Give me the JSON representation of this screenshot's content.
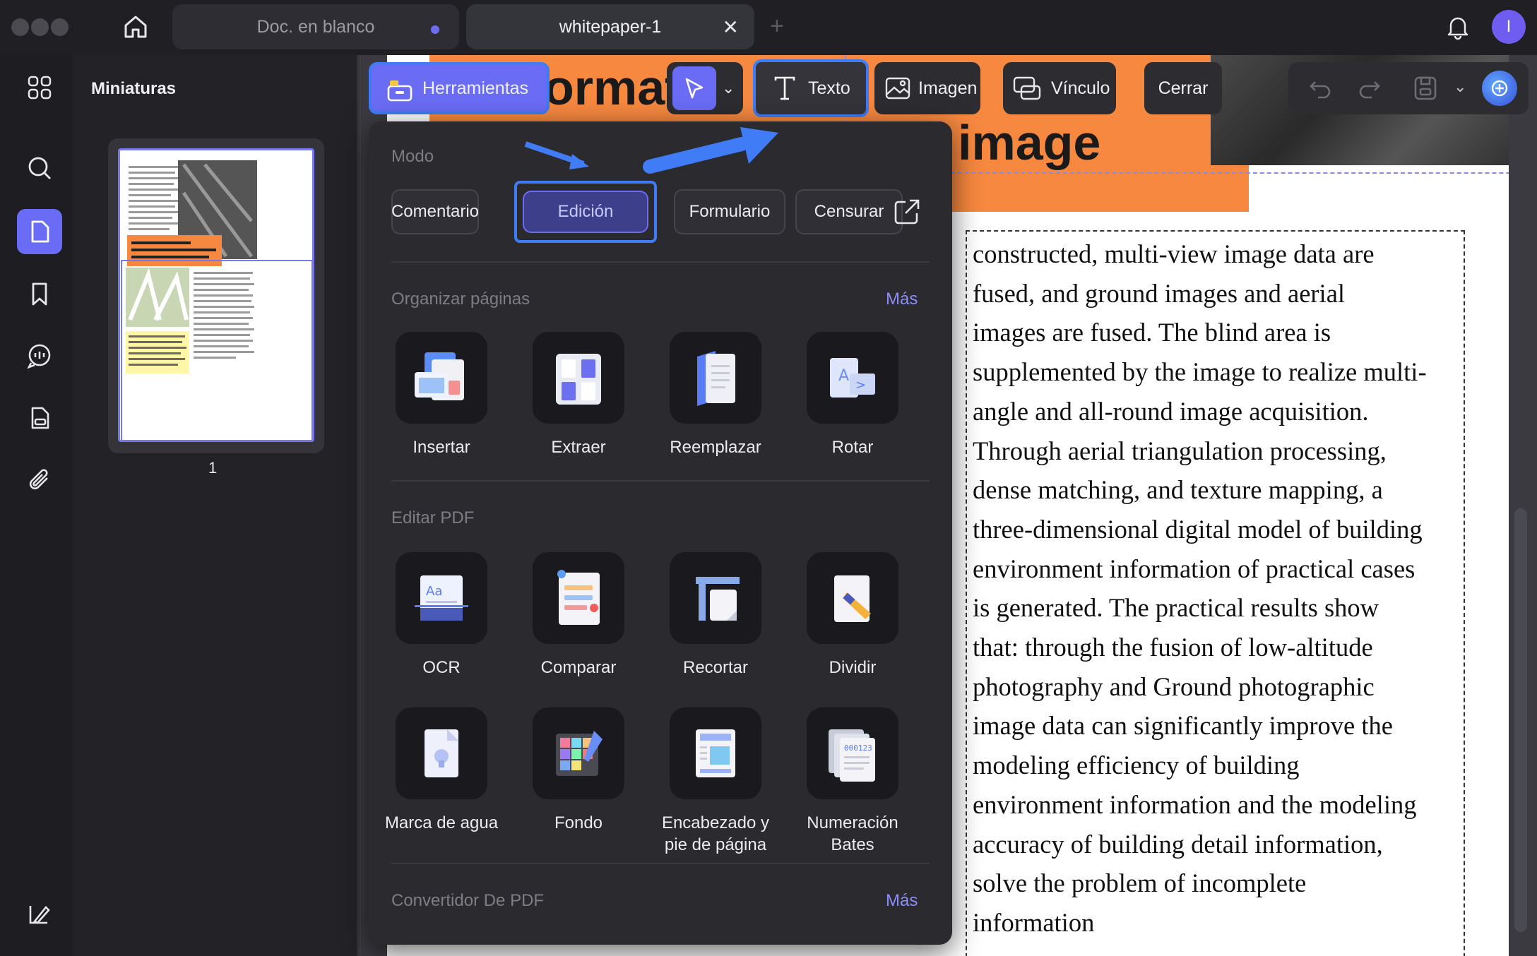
{
  "tabs": [
    {
      "label": "Doc. en blanco"
    },
    {
      "label": "whitepaper-1"
    }
  ],
  "user": {
    "initial": "I"
  },
  "thumbnails": {
    "title": "Miniaturas",
    "page_number": "1"
  },
  "toolbar": {
    "tools_label": "Herramientas",
    "text_label": "Texto",
    "image_label": "Imagen",
    "link_label": "Vínculo",
    "close_label": "Cerrar"
  },
  "panel": {
    "mode_label": "Modo",
    "modes": [
      "Comentario",
      "Edición",
      "Formulario",
      "Censurar"
    ],
    "selected_mode": "Edición",
    "organize": {
      "label": "Organizar páginas",
      "more": "Más",
      "items": [
        "Insertar",
        "Extraer",
        "Reemplazar",
        "Rotar"
      ]
    },
    "edit": {
      "label": "Editar PDF",
      "items": [
        "OCR",
        "Comparar",
        "Recortar",
        "Dividir",
        "Marca de agua",
        "Fondo",
        "Encabezado y pie de página",
        "Numeración Bates"
      ]
    },
    "convert": {
      "label": "Convertidor De PDF",
      "more": "Más"
    }
  },
  "document": {
    "title_fragment_1": "ormat",
    "title_fragment_2": "image",
    "body_lines": [
      "constructed, multi-view image data are",
      "fused, and ground images and aerial",
      "images are fused. The blind area is",
      "supplemented by the image to realize multi-",
      "angle and all-round image acquisition.",
      "Through aerial triangulation processing,",
      "dense matching, and texture mapping, a",
      "three-dimensional digital model of building",
      "environment information of practical cases",
      "is generated. The practical results show",
      "that: through the fusion of low-altitude",
      "photography and Ground photographic",
      "image data can significantly improve the",
      "modeling efficiency of building",
      "environment information and the modeling",
      "accuracy of building detail information,",
      "solve the problem of incomplete",
      "information"
    ]
  },
  "thumbnail_page": {
    "heading": "Building environment information modeling method based on multi-view image"
  }
}
